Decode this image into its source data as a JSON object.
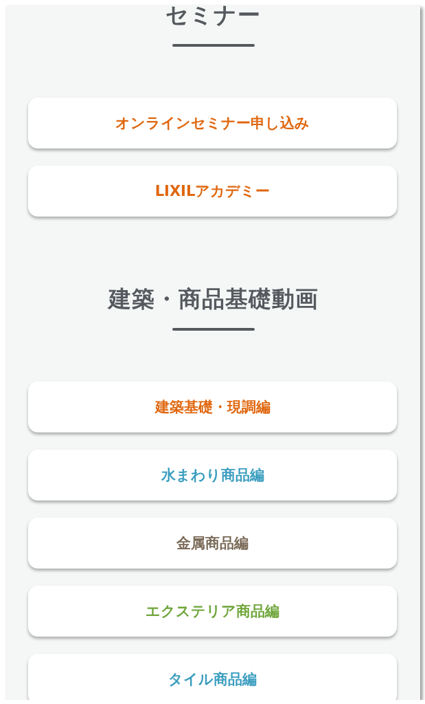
{
  "sections": [
    {
      "title": "セミナー",
      "links": [
        {
          "label": "オンラインセミナー申し込み",
          "color": "#e0670f"
        },
        {
          "label": "LIXILアカデミー",
          "color": "#e0670f"
        }
      ]
    },
    {
      "title": "建築・商品基礎動画",
      "links": [
        {
          "label": "建築基礎・現調編",
          "color": "#e0670f"
        },
        {
          "label": "水まわり商品編",
          "color": "#3a9dbf"
        },
        {
          "label": "金属商品編",
          "color": "#7a6a58"
        },
        {
          "label": "エクステリア商品編",
          "color": "#6fa53a"
        },
        {
          "label": "タイル商品編",
          "color": "#3a9dbf"
        }
      ]
    }
  ]
}
